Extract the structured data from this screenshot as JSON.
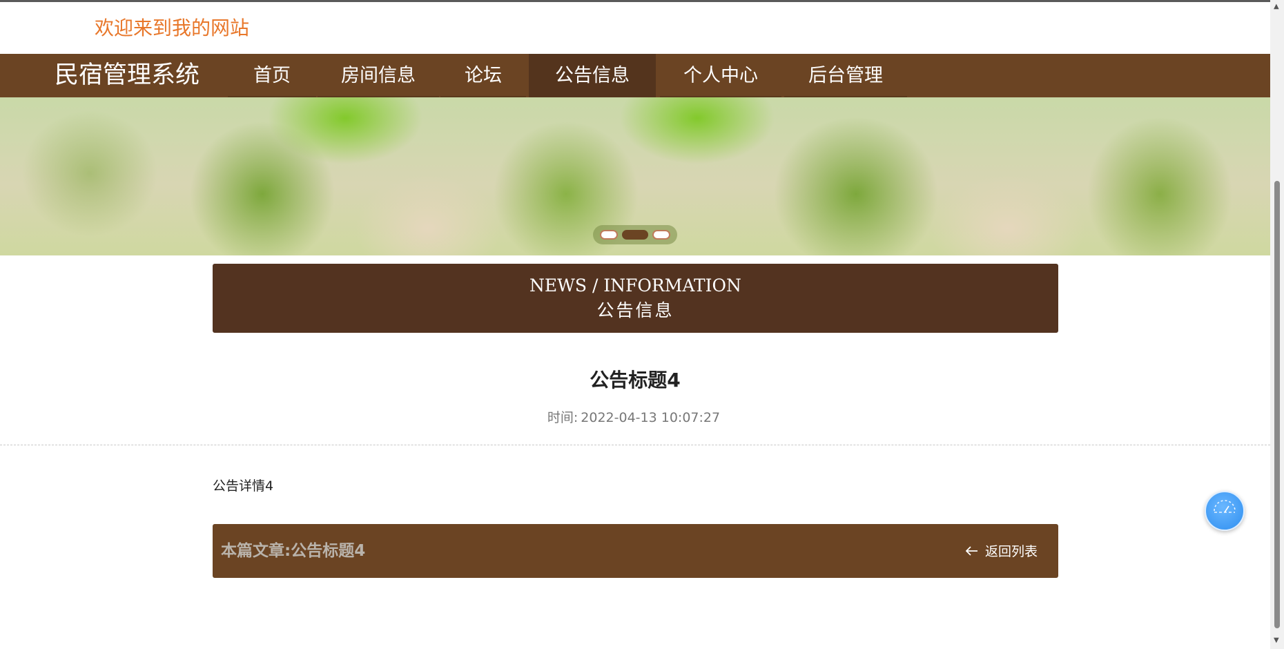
{
  "header": {
    "welcome": "欢迎来到我的网站",
    "brand": "民宿管理系统"
  },
  "nav": {
    "items": [
      {
        "label": "首页",
        "active": false
      },
      {
        "label": "房间信息",
        "active": false
      },
      {
        "label": "论坛",
        "active": false
      },
      {
        "label": "公告信息",
        "active": true
      },
      {
        "label": "个人中心",
        "active": false
      },
      {
        "label": "后台管理",
        "active": false
      }
    ]
  },
  "banner": {
    "slides": 3,
    "active_slide": 2
  },
  "section": {
    "title_en": "NEWS / INFORMATION",
    "title_cn": "公告信息"
  },
  "article": {
    "title": "公告标题4",
    "time_label": "时间:",
    "time_value": "2022-04-13 10:07:27",
    "content": "公告详情4"
  },
  "footer": {
    "current_label": "本篇文章:公告标题4",
    "back_label": "返回列表"
  },
  "colors": {
    "nav_bg": "#6b4423",
    "nav_active": "#54341d",
    "section_bg": "#533320",
    "welcome_text": "#e8772a",
    "float_button": "#2f8ff0"
  },
  "icons": {
    "back": "arrow-left-icon",
    "float": "gauge-icon"
  }
}
